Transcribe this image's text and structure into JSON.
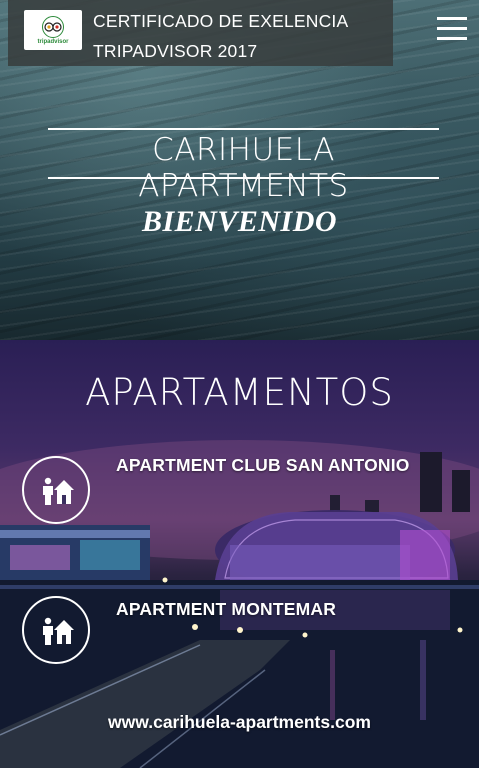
{
  "header": {
    "badge_line1": "CERTIFICADO DE EXELENCIA",
    "badge_line2": "TRIPADVISOR 2017",
    "logo_text": "tripadvisor",
    "logo_small": "CERTIFICATE of EXCELLENCE"
  },
  "hero": {
    "site_title": "CARIHUELA APARTMENTS",
    "welcome": "BIENVENIDO"
  },
  "apartments": {
    "section_title": "APARTAMENTOS",
    "items": [
      {
        "label": "APARTMENT CLUB SAN ANTONIO"
      },
      {
        "label": "APARTMENT MONTEMAR"
      }
    ]
  },
  "footer": {
    "url": "www.carihuela-apartments.com"
  },
  "colors": {
    "badge_bg": "#373c3c",
    "tripadvisor_green": "#2c8a3a",
    "text": "#ffffff"
  }
}
